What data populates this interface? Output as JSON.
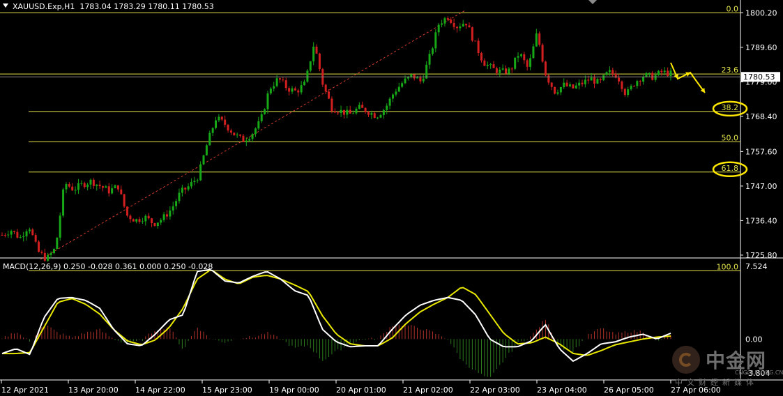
{
  "header": {
    "symbol_info": "XAUUSD.Exp,H1  1783.04 1783.29 1780.11 1780.53",
    "macd_info": "MACD(12,26,9) 0.250 -0.028 0.361 0.000 0.250 -0.028"
  },
  "chart_data": [
    {
      "type": "candlestick",
      "symbol": "XAUUSD.Exp",
      "timeframe": "H1",
      "ohlc_current": {
        "open": 1783.04,
        "high": 1783.29,
        "low": 1780.11,
        "close": 1780.53
      },
      "current_price_label": "1780.53",
      "y_ticks": [
        "1800.20",
        "1789.60",
        "1779.00",
        "1768.40",
        "1757.60",
        "1747.00",
        "1736.40",
        "1725.80"
      ],
      "ylim": [
        1723.0,
        1802.2
      ],
      "x_ticks": [
        "12 Apr 2021",
        "13 Apr 20:00",
        "14 Apr 22:00",
        "15 Apr 23:00",
        "19 Apr 00:00",
        "20 Apr 01:00",
        "21 Apr 02:00",
        "22 Apr 03:00",
        "23 Apr 04:00",
        "26 Apr 05:00",
        "27 Apr 06:00"
      ],
      "fibonacci_levels": [
        {
          "label": "0.0",
          "price": 1800.2
        },
        {
          "label": "23.6",
          "price": 1781.4
        },
        {
          "label": "38.2",
          "price": 1769.9
        },
        {
          "label": "50.0",
          "price": 1760.6
        },
        {
          "label": "61.8",
          "price": 1751.3
        },
        {
          "label": "100.0",
          "price": 1721.0
        }
      ],
      "highlighted_levels": [
        "38.2",
        "61.8"
      ],
      "trendline": {
        "from_price": 1724.5,
        "to_price": 1800.8,
        "style": "dashed",
        "color": "#d23c2a"
      },
      "price_path": [
        1732.0,
        1733.5,
        1731.0,
        1735.0,
        1727.0,
        1724.5,
        1728.0,
        1748.0,
        1746.0,
        1747.5,
        1748.5,
        1747.0,
        1745.5,
        1747.0,
        1738.0,
        1736.5,
        1737.5,
        1735.5,
        1737.0,
        1740.0,
        1745.0,
        1747.0,
        1750.0,
        1760.0,
        1768.0,
        1766.0,
        1763.0,
        1761.0,
        1763.0,
        1767.0,
        1777.0,
        1780.0,
        1777.0,
        1776.0,
        1778.5,
        1791.0,
        1778.0,
        1771.0,
        1770.0,
        1769.0,
        1771.0,
        1770.0,
        1768.5,
        1771.0,
        1776.0,
        1779.0,
        1781.0,
        1779.0,
        1787.0,
        1797.0,
        1799.0,
        1796.0,
        1797.5,
        1791.0,
        1785.0,
        1783.0,
        1782.0,
        1782.5,
        1788.0,
        1783.0,
        1794.0,
        1781.0,
        1776.0,
        1778.0,
        1777.0,
        1778.5,
        1780.0,
        1778.5,
        1782.0,
        1781.0,
        1775.0,
        1779.0,
        1781.0,
        1780.5,
        1782.0,
        1781.5
      ],
      "annotation_arrows": "yellow zigzag arrows projecting down toward 38.2",
      "colors": {
        "bull": "#17a817",
        "bear": "#d21f1f",
        "fib": "#e6e64a",
        "background": "#000000",
        "grid_text": "#ffffff"
      }
    },
    {
      "type": "macd",
      "params": "MACD(12,26,9)",
      "values": {
        "macd": 0.25,
        "signal": -0.028
      },
      "y_ticks": [
        "7.524",
        "0.00",
        "-3.804"
      ],
      "ylim": [
        -3.804,
        7.524
      ],
      "macd_path": [
        -1.5,
        -1.0,
        -1.6,
        2.2,
        4.2,
        4.3,
        4.0,
        3.2,
        1.0,
        -0.5,
        -0.7,
        0.5,
        2.0,
        2.5,
        7.0,
        7.2,
        6.0,
        5.8,
        6.5,
        7.0,
        6.2,
        5.0,
        4.5,
        1.0,
        -0.3,
        -0.8,
        -0.7,
        -0.7,
        1.0,
        2.5,
        3.5,
        4.0,
        4.3,
        4.0,
        2.5,
        0.0,
        -0.8,
        -0.8,
        -0.2,
        1.5,
        -1.0,
        -2.3,
        -1.5,
        -0.5,
        -0.3,
        0.2,
        0.5,
        0.0,
        0.6
      ],
      "signal_path": [
        -1.5,
        -1.5,
        -1.4,
        1.2,
        3.8,
        4.2,
        3.6,
        2.6,
        1.0,
        -0.2,
        -0.6,
        -0.1,
        1.2,
        3.2,
        6.2,
        7.2,
        6.2,
        5.7,
        6.4,
        6.6,
        6.2,
        5.6,
        4.9,
        2.4,
        0.5,
        -0.5,
        -0.7,
        -0.7,
        0.1,
        1.6,
        2.8,
        3.6,
        4.3,
        5.4,
        4.6,
        2.6,
        0.6,
        -0.5,
        -0.4,
        0.2,
        -0.5,
        -1.5,
        -1.7,
        -1.2,
        -0.6,
        -0.3,
        0.0,
        0.2,
        0.3
      ],
      "colors": {
        "macd_line": "#ffffff",
        "signal_line": "#e8e800",
        "hist_pos": "#b2322a",
        "hist_neg": "#2e7d1e"
      }
    }
  ],
  "watermark": {
    "brand": "中金网",
    "subtitle": "中文财经新媒体",
    "url": "CNGOLD.ORG.CN"
  }
}
